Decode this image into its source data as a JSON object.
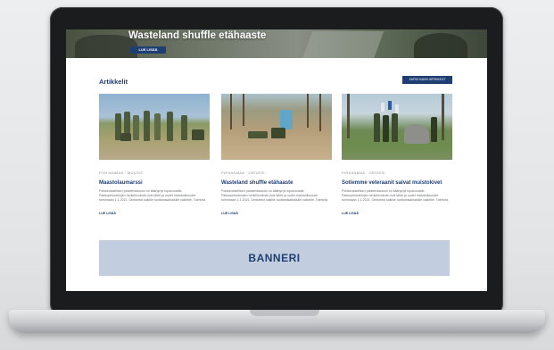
{
  "hero": {
    "title": "Wasteland shuffle etähaaste",
    "button_label": "LUE LISÄÄ"
  },
  "articles": {
    "section_title": "Artikkelit",
    "all_button_label": "KATSO KAIKKI ARTIKKELIT",
    "cards": [
      {
        "meta": "POHJANMAA · MUUSIC",
        "title": "Maastolaumarssi",
        "excerpt": "Poikkeuksellisen pandemiavuosi on käänynyt lopusuoralle. Pakkoperustelujen henkilövoimat ovat lähtö ja uudet mahdollisuudet toimintaan 1.1.2021. Omistetut kaikille tuottamisalhaisille valkeille. Toiminta on jatkunut ja päättänyt. lehty myös…",
        "more": "LUE LISÄÄ"
      },
      {
        "meta": "PIRKANMAA · ORIVESI",
        "title": "Wasteland shuffle etähaaste",
        "excerpt": "Poikkeuksellisen pandemiavuosi on käänynyt lopusuoralle. Pakkoperustelujen henkilövoimat ovat lähtö ja uudet mahdollisuudet toimintaan 1.1.2021. Omistetut kaikille tuottamisalhaisille valkeille. Toiminta on jatkunut ja päättänyt. lehty myös…",
        "more": "LUE LISÄÄ"
      },
      {
        "meta": "PIRKANMAA · ORIVESI",
        "title": "Sotiemme veteraanit saivat muistokivet",
        "excerpt": "Poikkeuksellisen pandemiavuosi on käänynyt lopusuoralle. Pakkoperustelujen henkilövoimat ovat lähtö ja uudet mahdollisuudet toimintaan 1.1.2021. Omistetut kaikille tuottamisalhaisille valkeille. Toiminta on jatkunut ja päättänyt. lehty myös…",
        "more": "LUE LISÄÄ"
      }
    ]
  },
  "banner": {
    "label": "BANNERI"
  },
  "colors": {
    "brand": "#1f3f73",
    "banner_bg": "#c2cedf"
  }
}
